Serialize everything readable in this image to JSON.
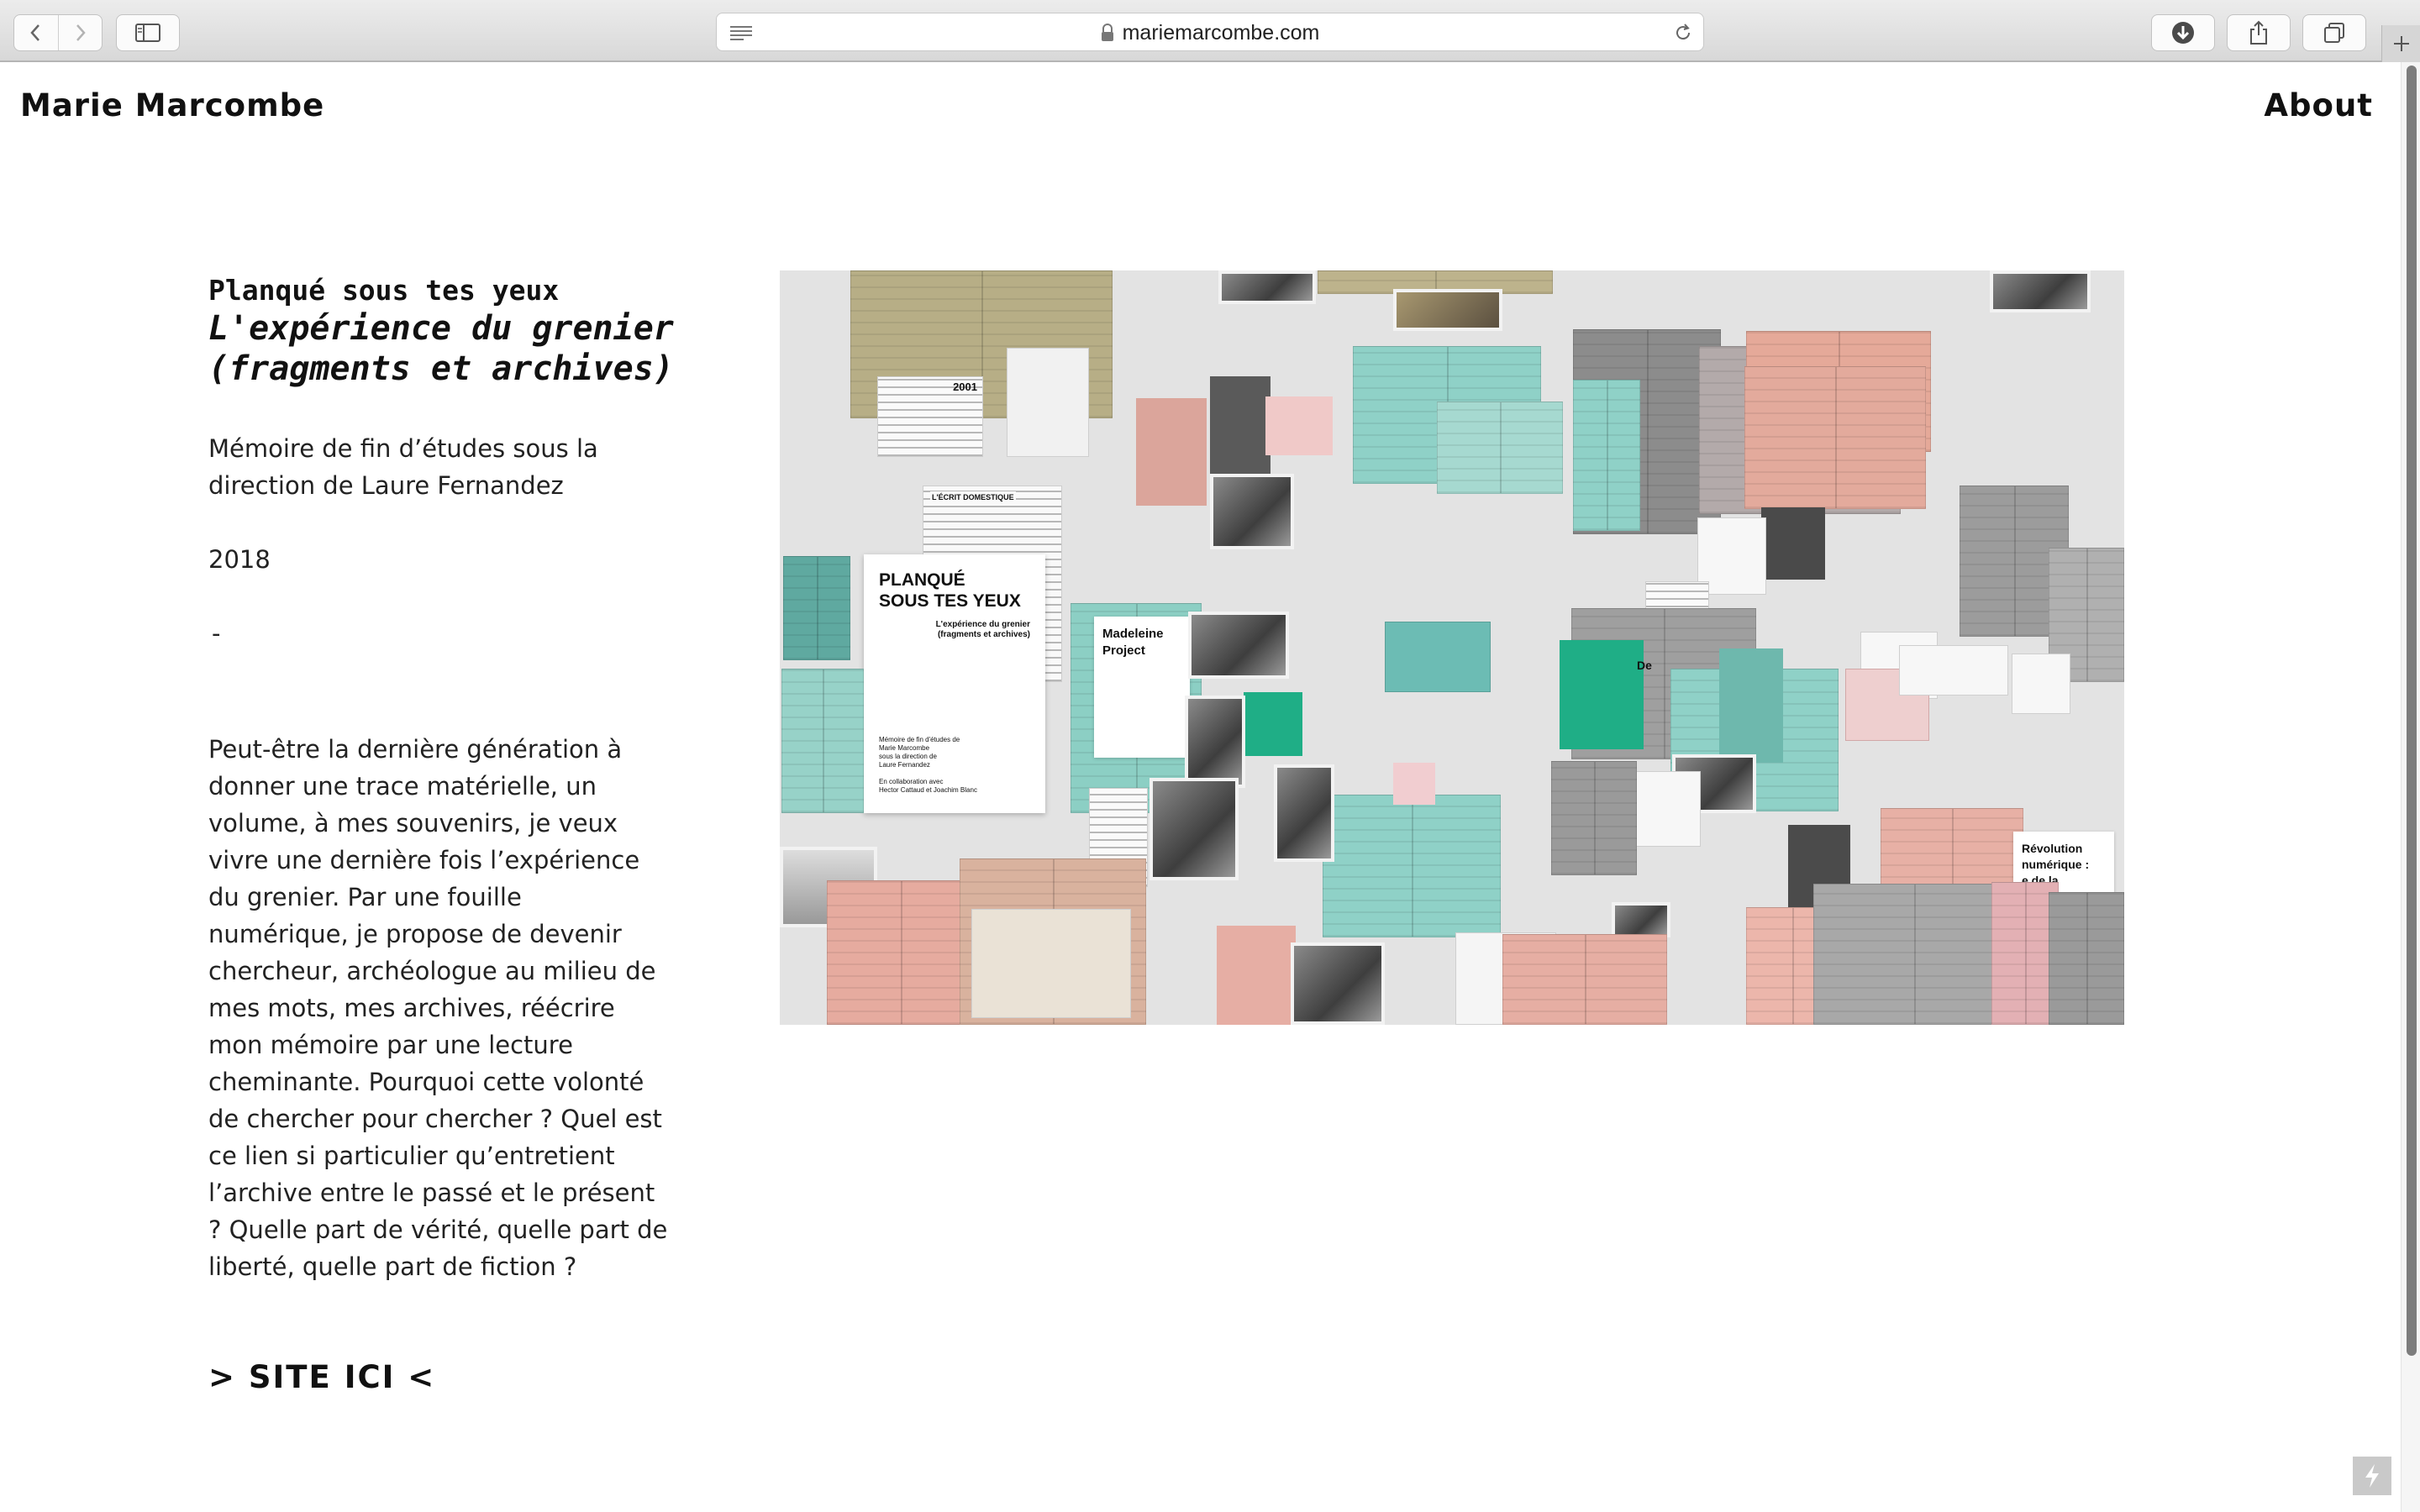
{
  "browser": {
    "url": "mariemarcombe.com",
    "icons": [
      "back-icon",
      "forward-icon",
      "sidebar-icon",
      "reader-icon",
      "lock-icon",
      "reload-icon",
      "download-icon",
      "share-icon",
      "tabs-icon",
      "new-tab-icon"
    ]
  },
  "header": {
    "site_name": "Marie Marcombe",
    "about": "About"
  },
  "project": {
    "title": "Planqué sous tes yeux",
    "subtitle": "L'expérience du grenier (fragments et archives)",
    "description": "Mémoire de fin d’études sous la direction de Laure Fernandez",
    "year": "2018",
    "separator": "-",
    "body": "Peut-être la dernière génération à donner une trace matérielle, un volume, à mes souvenirs, je veux vivre une dernière fois l’expérience du grenier. Par une fouille numérique, je propose de devenir chercheur, archéologue au milieu de mes mots, mes archives, réécrire mon mémoire par une lecture cheminante. Pourquoi cette volonté de chercher pour chercher ? Quel est ce lien si particulier qu’entretient l’archive entre le passé et le présent ? Quelle part de vérité, quelle part de liberté, quelle part de fiction ?",
    "site_link": "> SITE ICI <"
  },
  "collage": {
    "cover_title": "PLANQUÉ\nSOUS TES YEUX",
    "cover_subtitle": "L'expérience du grenier\n(fragments et archives)",
    "cover_credit": "Mémoire de fin d'études de\nMarie Marcombe\nsous la direction de\nLaure Fernandez\n\nEn collaboration avec\nHector Cattaud et Joachim Blanc",
    "ecrit_label": "L'ÉCRIT DOMESTIQUE",
    "calendar_year": "2001",
    "madeleine": "Madeleine\nProject",
    "revolution": "Révolution\nnumérique :\n  e de la\n  isation",
    "de_label": "De",
    "colors": {
      "olive": "#b6ad84",
      "pink": "#e4aca2",
      "teal": "#8fd1c7",
      "green": "#1fae86",
      "grey": "#9a9a9a",
      "magenta": "#e048c0"
    }
  }
}
